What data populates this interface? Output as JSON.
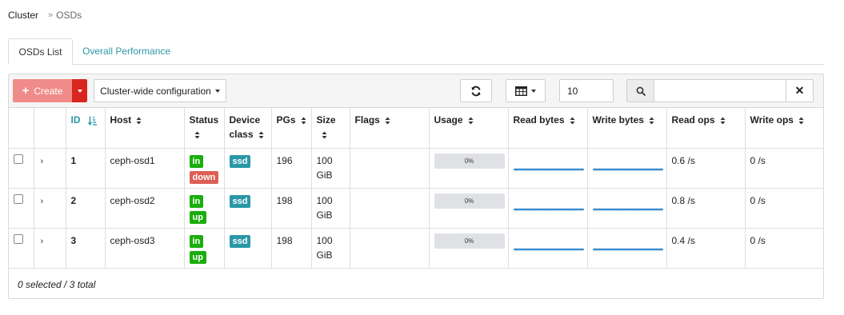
{
  "breadcrumb": {
    "parent": "Cluster",
    "separator": "»",
    "current": "OSDs"
  },
  "tabs": [
    {
      "label": "OSDs List",
      "active": true
    },
    {
      "label": "Overall Performance",
      "active": false
    }
  ],
  "toolbar": {
    "create_label": "Create",
    "config_label": "Cluster-wide configuration",
    "page_limit": "10",
    "search_value": ""
  },
  "colors": {
    "create_bg": "#ef8c89",
    "create_toggle_bg": "#d9251f",
    "link": "#2b99a8",
    "badge_in": "#1aae0c",
    "badge_down": "#dd5f55",
    "badge_ssd": "#2a97a7",
    "sparkline": "#3a8bd0"
  },
  "table": {
    "headers": {
      "id": "ID",
      "host": "Host",
      "status": "Status",
      "device_class_1": "Device",
      "device_class_2": "class",
      "pgs": "PGs",
      "size": "Size",
      "flags": "Flags",
      "usage": "Usage",
      "read_bytes": "Read bytes",
      "write_bytes": "Write bytes",
      "read_ops": "Read ops",
      "write_ops": "Write ops"
    },
    "rows": [
      {
        "id": "1",
        "host": "ceph-osd1",
        "status_in": "in",
        "status_updown": "down",
        "status_updown_color": "red",
        "device_class": "ssd",
        "pgs": "196",
        "size_1": "100",
        "size_2": "GiB",
        "flags": "",
        "usage_text": "0%",
        "usage_fraction": 0,
        "read_ops": "0.6 /s",
        "write_ops": "0 /s"
      },
      {
        "id": "2",
        "host": "ceph-osd2",
        "status_in": "in",
        "status_updown": "up",
        "status_updown_color": "green",
        "device_class": "ssd",
        "pgs": "198",
        "size_1": "100",
        "size_2": "GiB",
        "flags": "",
        "usage_text": "0%",
        "usage_fraction": 0,
        "read_ops": "0.8 /s",
        "write_ops": "0 /s"
      },
      {
        "id": "3",
        "host": "ceph-osd3",
        "status_in": "in",
        "status_updown": "up",
        "status_updown_color": "green",
        "device_class": "ssd",
        "pgs": "198",
        "size_1": "100",
        "size_2": "GiB",
        "flags": "",
        "usage_text": "0%",
        "usage_fraction": 0,
        "read_ops": "0.4 /s",
        "write_ops": "0 /s"
      }
    ]
  },
  "footer": {
    "summary": "0 selected / 3 total"
  },
  "icons": {
    "create": "plus-icon",
    "refresh": "refresh-icon",
    "columns": "table-columns-icon",
    "search": "search-icon",
    "clear": "close-icon",
    "expand": "chevron-right-icon",
    "sort": "sort-icon"
  }
}
